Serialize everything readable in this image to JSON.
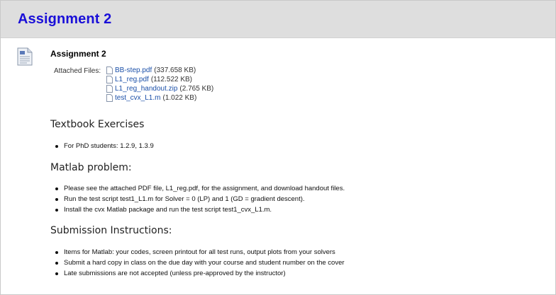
{
  "page": {
    "title": "Assignment 2",
    "colors": {
      "title": "#1a0fd8",
      "link": "#1a4fa8",
      "header_bg": "#dedede"
    }
  },
  "item": {
    "icon": "document-icon",
    "title": "Assignment 2",
    "attached_label": "Attached Files:",
    "files": [
      {
        "name": "BB-step.pdf",
        "size": "(337.658 KB)"
      },
      {
        "name": "L1_reg.pdf",
        "size": "(112.522 KB)"
      },
      {
        "name": "L1_reg_handout.zip",
        "size": "(2.765 KB)"
      },
      {
        "name": "test_cvx_L1.m",
        "size": "(1.022 KB)"
      }
    ]
  },
  "sections": [
    {
      "heading": "Textbook Exercises",
      "bullets": [
        "For PhD students: 1.2.9, 1.3.9"
      ]
    },
    {
      "heading": "Matlab problem:",
      "bullets": [
        "Please see the attached PDF file, L1_reg.pdf, for the assignment, and download handout files.",
        "Run the test script test1_L1.m for Solver = 0 (LP) and 1 (GD = gradient descent).",
        "Install the cvx Matlab package and run the test script test1_cvx_L1.m."
      ]
    },
    {
      "heading": "Submission Instructions:",
      "bullets": [
        "Items for Matlab: your codes, screen printout for all test runs, output plots from your solvers",
        "Submit a hard copy in class on the due day with your course and student number on the cover",
        "Late submissions are not accepted (unless pre-approved by the instructor)"
      ]
    }
  ]
}
